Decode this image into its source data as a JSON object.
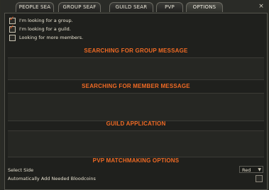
{
  "tabs": [
    {
      "label": "PEOPLE SEA"
    },
    {
      "label": "GROUP SEAF"
    },
    {
      "label": "GUILD SEAR"
    },
    {
      "label": "PVP"
    },
    {
      "label": "OPTIONS"
    }
  ],
  "close_label": "×",
  "checks": [
    {
      "label": "I'm looking for a group.",
      "checked": true
    },
    {
      "label": "I'm looking for a guild.",
      "checked": true
    },
    {
      "label": "Looking for more members.",
      "checked": false
    }
  ],
  "sections": {
    "group_message": "SEARCHING FOR GROUP MESSAGE",
    "member_message": "SEARCHING FOR MEMBER MESSAGE",
    "guild_application": "GUILD APPLICATION",
    "pvp_options": "PVP MATCHMAKING OPTIONS"
  },
  "pvp": {
    "select_side_label": "Select Side",
    "select_side_value": "Red",
    "auto_bloodcoins_label": "Automatically Add Needed Bloodcoins",
    "auto_bloodcoins_checked": false
  },
  "colors": {
    "accent": "#f06a24",
    "check": "#e0551b"
  }
}
